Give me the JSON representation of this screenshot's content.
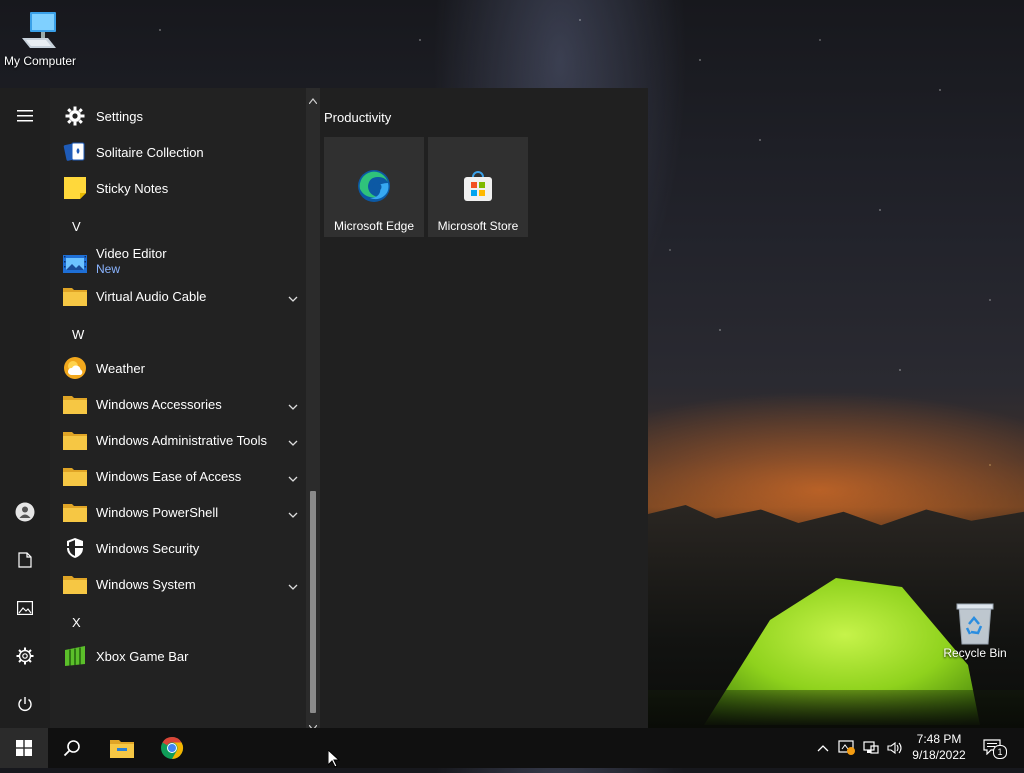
{
  "desktop": {
    "icons": [
      {
        "label": "My Computer"
      },
      {
        "label": "Recycle Bin"
      }
    ]
  },
  "start_menu": {
    "apps": [
      {
        "type": "app",
        "label": "Settings",
        "icon": "gear-icon"
      },
      {
        "type": "app",
        "label": "Solitaire Collection",
        "icon": "cards-icon"
      },
      {
        "type": "app",
        "label": "Sticky Notes",
        "icon": "sticky-note-icon"
      },
      {
        "type": "letter",
        "label": "V"
      },
      {
        "type": "app",
        "label": "Video Editor",
        "sublabel": "New",
        "icon": "video-editor-icon"
      },
      {
        "type": "folder",
        "label": "Virtual Audio Cable",
        "icon": "folder-icon"
      },
      {
        "type": "letter",
        "label": "W"
      },
      {
        "type": "app",
        "label": "Weather",
        "icon": "weather-icon"
      },
      {
        "type": "folder",
        "label": "Windows Accessories",
        "icon": "folder-icon"
      },
      {
        "type": "folder",
        "label": "Windows Administrative Tools",
        "icon": "folder-icon"
      },
      {
        "type": "folder",
        "label": "Windows Ease of Access",
        "icon": "folder-icon"
      },
      {
        "type": "folder",
        "label": "Windows PowerShell",
        "icon": "folder-icon"
      },
      {
        "type": "app",
        "label": "Windows Security",
        "icon": "shield-icon"
      },
      {
        "type": "folder",
        "label": "Windows System",
        "icon": "folder-icon"
      },
      {
        "type": "letter",
        "label": "X"
      },
      {
        "type": "app",
        "label": "Xbox Game Bar",
        "icon": "xbox-game-bar-icon"
      }
    ],
    "tile_group": {
      "title": "Productivity",
      "tiles": [
        {
          "label": "Microsoft Edge",
          "icon": "edge-icon"
        },
        {
          "label": "Microsoft Store",
          "icon": "store-icon"
        }
      ]
    },
    "rail_icons": [
      "hamburger-menu-icon",
      "user-icon",
      "documents-icon",
      "pictures-icon",
      "settings-gear-icon",
      "power-icon"
    ]
  },
  "taskbar": {
    "pinned": [
      "windows-start-icon",
      "search-icon",
      "file-explorer-icon",
      "chrome-icon"
    ],
    "tray_icons": [
      "chevron-up-icon",
      "security-alert-icon",
      "network-icon",
      "volume-icon"
    ],
    "time": "7:48 PM",
    "date": "9/18/2022",
    "notification_count": "1"
  },
  "colors": {
    "menu_bg": "#1f1f1f",
    "tile_bg": "#303030",
    "accent_blue": "#8ab4ff",
    "folder_yellow": "#f6c744"
  }
}
